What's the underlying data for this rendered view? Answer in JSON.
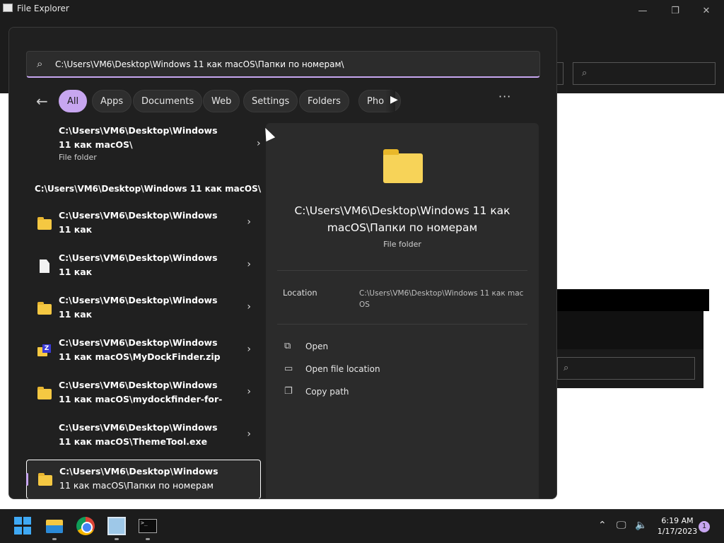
{
  "window": {
    "title": "File Explorer",
    "minimize_glyph": "—",
    "maximize_glyph": "❐",
    "close_glyph": "✕"
  },
  "search": {
    "query": "C:\\Users\\VM6\\Desktop\\Windows 11 как macOS\\Папки по номерам\\",
    "placeholder": "",
    "icon": "search-icon",
    "accent_color": "#c7a6f0"
  },
  "filters": {
    "back_glyph": "←",
    "chips": [
      {
        "label": "All",
        "active": true
      },
      {
        "label": "Apps",
        "active": false
      },
      {
        "label": "Documents",
        "active": false
      },
      {
        "label": "Web",
        "active": false
      },
      {
        "label": "Settings",
        "active": false
      },
      {
        "label": "Folders",
        "active": false
      },
      {
        "label": "Pho",
        "active": false
      }
    ],
    "more_glyph": "▶",
    "ellipsis": "···"
  },
  "best_match": {
    "title_line1": "C:\\Users\\VM6\\Desktop\\Windows",
    "title_line2": "11 как macOS\\",
    "subtitle": "File folder"
  },
  "section_heading": "C:\\Users\\VM6\\Desktop\\Windows 11 как macOS\\",
  "results": [
    {
      "line1": "C:\\Users\\VM6\\Desktop\\Windows",
      "line2": "11 как",
      "icon": "folder-icon"
    },
    {
      "line1": "C:\\Users\\VM6\\Desktop\\Windows",
      "line2": "11 как",
      "icon": "file-icon"
    },
    {
      "line1": "C:\\Users\\VM6\\Desktop\\Windows",
      "line2": "11 как",
      "icon": "folder-icon"
    },
    {
      "line1": "C:\\Users\\VM6\\Desktop\\Windows",
      "line2": "11 как macOS\\MyDockFinder.zip",
      "icon": "zip-icon"
    },
    {
      "line1": "C:\\Users\\VM6\\Desktop\\Windows",
      "line2": "11 как macOS\\mydockfinder-for-",
      "icon": "folder-icon"
    },
    {
      "line1": "C:\\Users\\VM6\\Desktop\\Windows",
      "line2": "11 как macOS\\ThemeTool.exe",
      "icon": "exe-icon"
    },
    {
      "line1": "C:\\Users\\VM6\\Desktop\\Windows",
      "line2": "11 как macOS\\Папки по номерам",
      "icon": "folder-icon",
      "selected": true
    }
  ],
  "chevron_glyph": "›",
  "preview": {
    "title_line1": "C:\\Users\\VM6\\Desktop\\Windows 11 как",
    "title_line2": "macOS\\Папки по номерам",
    "type": "File folder",
    "location_label": "Location",
    "location_value": "C:\\Users\\VM6\\Desktop\\Windows 11 как macOS",
    "actions": [
      {
        "label": "Open",
        "icon": "open-external-icon",
        "glyph": "⧉"
      },
      {
        "label": "Open file location",
        "icon": "folder-outline-icon",
        "glyph": "▭"
      },
      {
        "label": "Copy path",
        "icon": "copy-icon",
        "glyph": "❐"
      }
    ]
  },
  "taskbar": {
    "clock_time": "6:19 AM",
    "clock_date": "1/17/2023",
    "notification_count": "1",
    "tray_chevron": "⌃",
    "network_glyph": "🖵",
    "volume_glyph": "🔈"
  }
}
